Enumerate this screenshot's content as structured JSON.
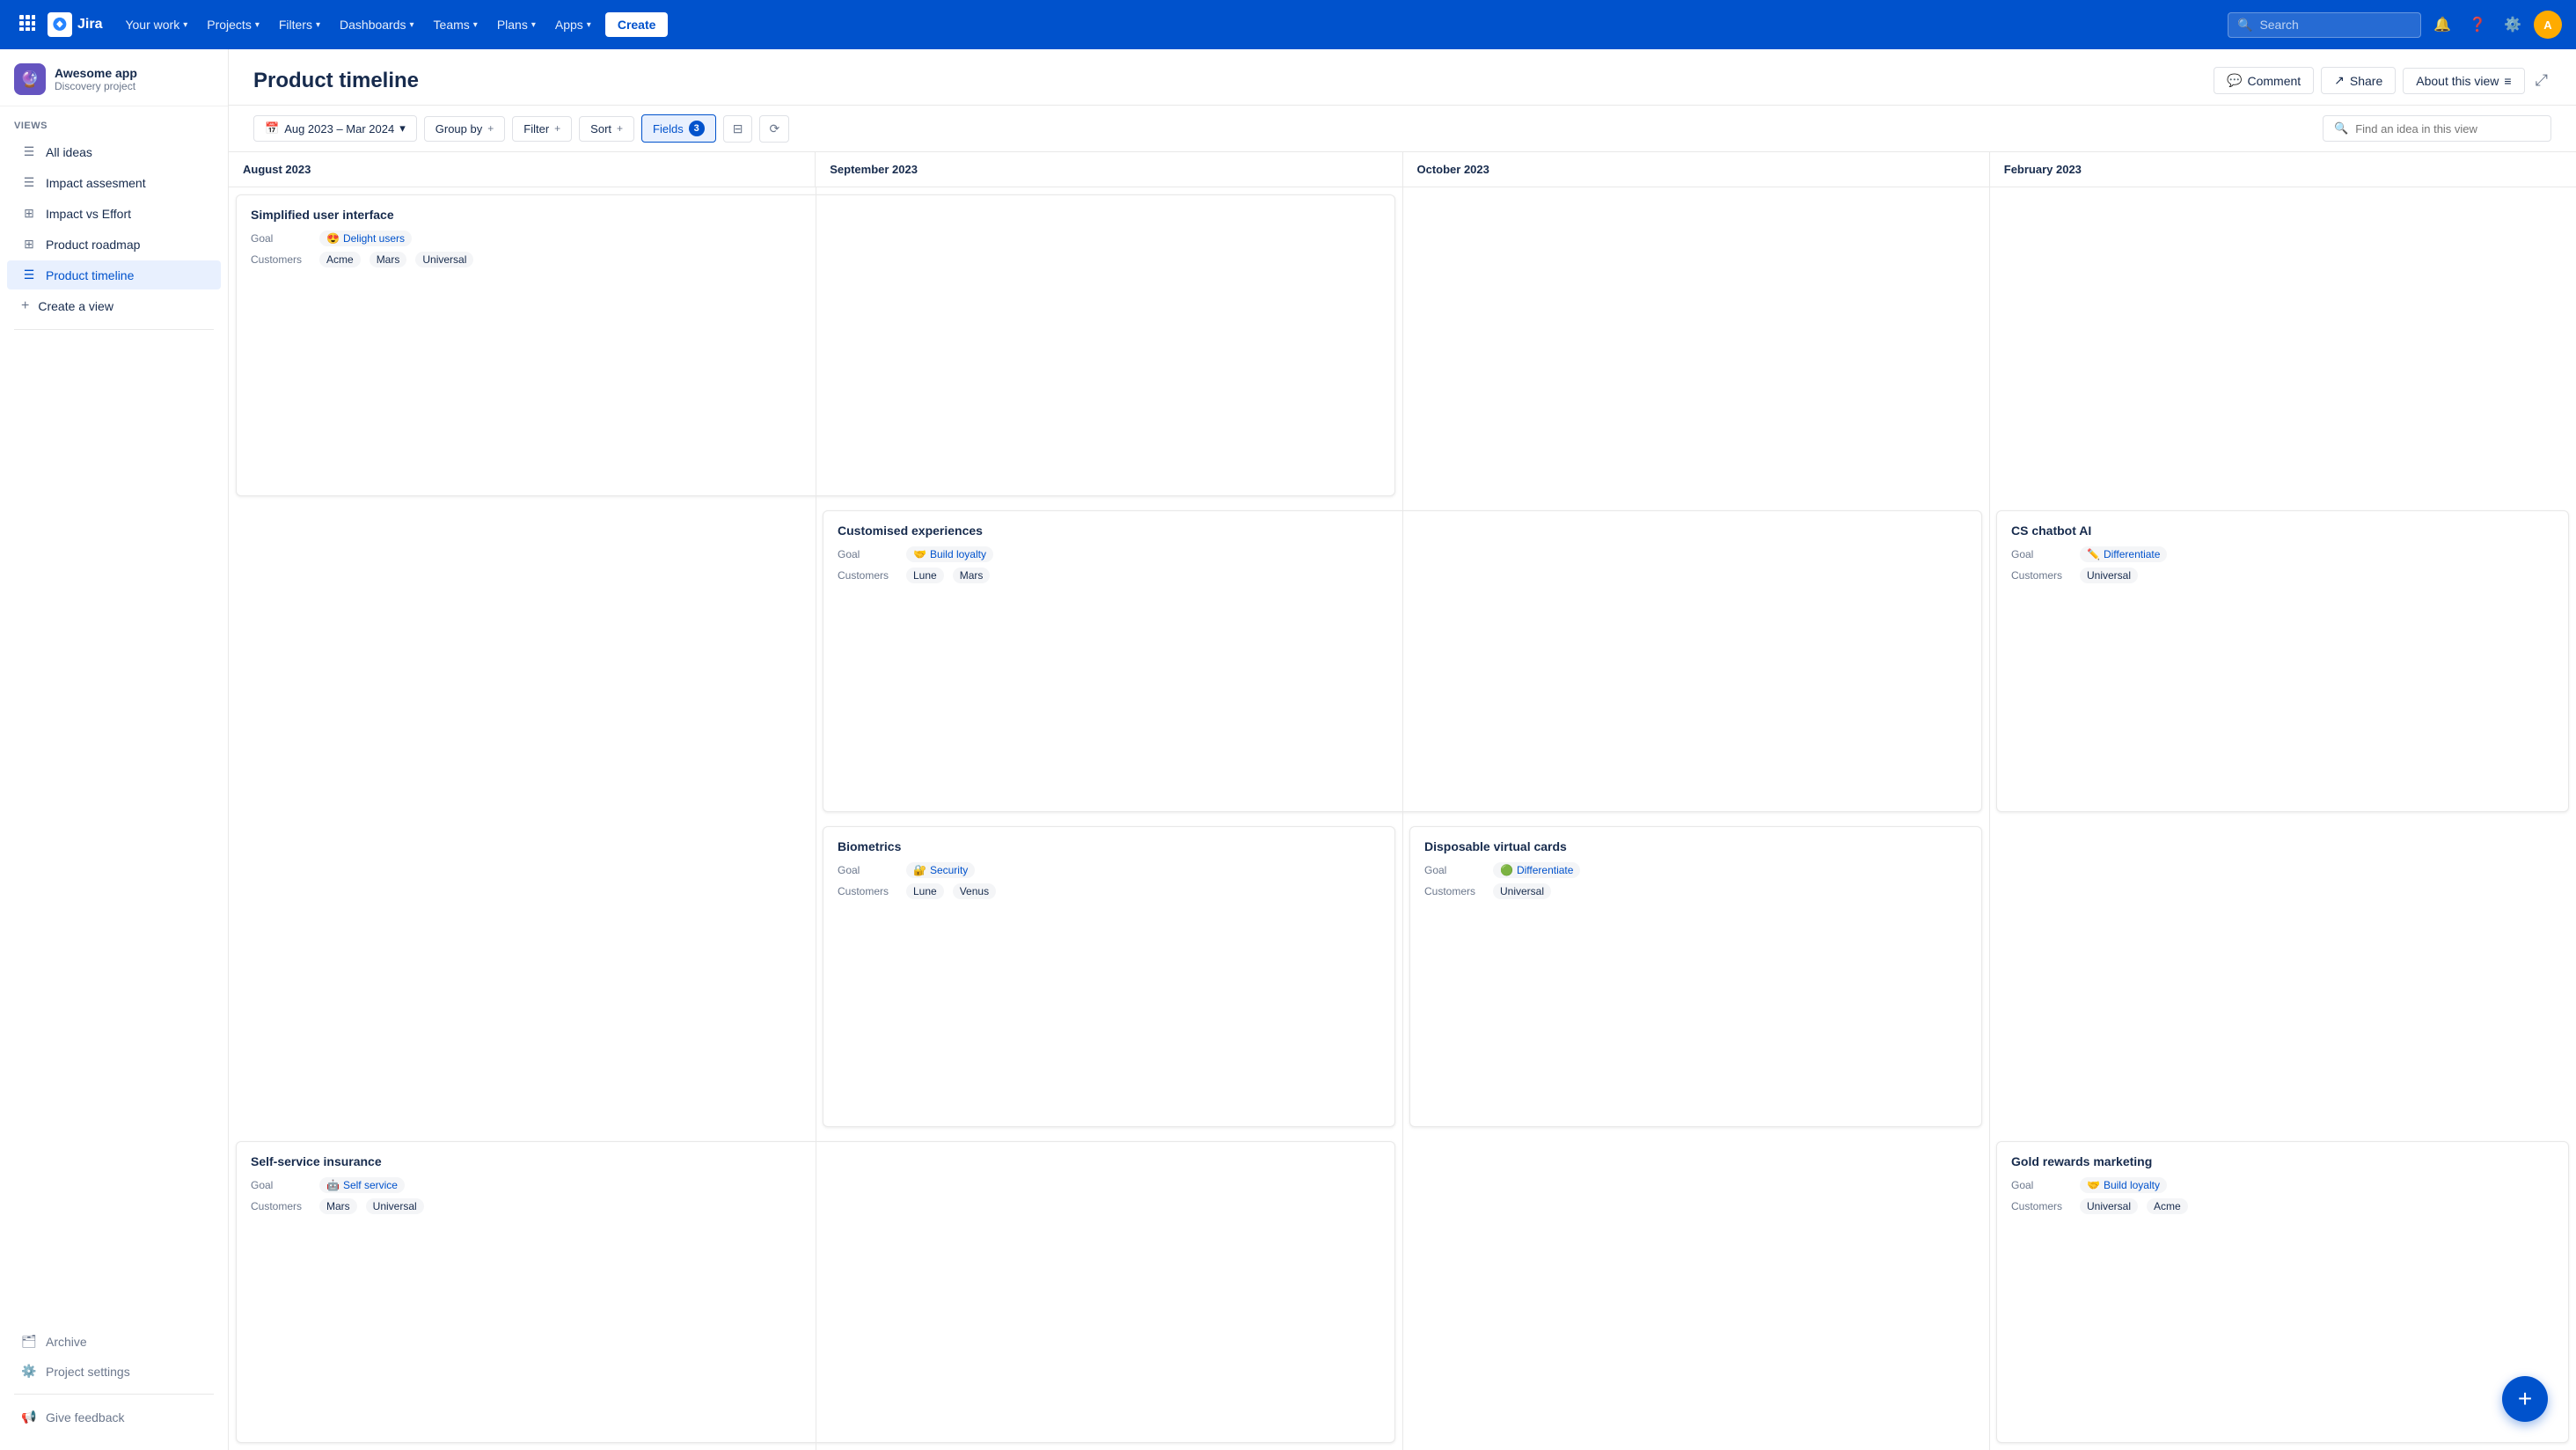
{
  "nav": {
    "logo_text": "Jira",
    "items": [
      {
        "label": "Your work",
        "has_dropdown": true
      },
      {
        "label": "Projects",
        "has_dropdown": true
      },
      {
        "label": "Filters",
        "has_dropdown": true
      },
      {
        "label": "Dashboards",
        "has_dropdown": true
      },
      {
        "label": "Teams",
        "has_dropdown": true
      },
      {
        "label": "Plans",
        "has_dropdown": true
      },
      {
        "label": "Apps",
        "has_dropdown": true
      }
    ],
    "create_label": "Create",
    "search_placeholder": "Search"
  },
  "sidebar": {
    "project_name": "Awesome app",
    "project_sub": "Discovery project",
    "views_label": "VIEWS",
    "add_view_label": "+",
    "items": [
      {
        "label": "All ideas",
        "icon": "☰"
      },
      {
        "label": "Impact assesment",
        "icon": "☰"
      },
      {
        "label": "Impact vs Effort",
        "icon": "⊞"
      },
      {
        "label": "Product roadmap",
        "icon": "⊞"
      },
      {
        "label": "Product timeline",
        "icon": "☰",
        "active": true
      }
    ],
    "create_view_label": "Create a view",
    "archive_label": "Archive",
    "settings_label": "Project settings",
    "feedback_label": "Give feedback"
  },
  "page": {
    "title": "Product timeline",
    "comment_label": "Comment",
    "share_label": "Share",
    "about_label": "About this view"
  },
  "toolbar": {
    "date_range": "Aug 2023 – Mar 2024",
    "group_by_label": "Group by",
    "filter_label": "Filter",
    "sort_label": "Sort",
    "fields_label": "Fields",
    "fields_count": "3",
    "search_placeholder": "Find an idea in this view"
  },
  "months": [
    {
      "label": "August 2023"
    },
    {
      "label": "September 2023"
    },
    {
      "label": "October 2023"
    },
    {
      "label": "February 2023"
    }
  ],
  "ideas": [
    {
      "id": "card1",
      "title": "Simplified user interface",
      "goal_emoji": "😍",
      "goal_label": "Delight users",
      "goal_type": "delight",
      "customers": [
        "Acme",
        "Mars",
        "Universal"
      ],
      "col_start": 1,
      "col_end": 3,
      "row": 1
    },
    {
      "id": "card2",
      "title": "Customised experiences",
      "goal_emoji": "🤝",
      "goal_label": "Build loyalty",
      "goal_type": "loyalty",
      "customers": [
        "Lune",
        "Mars"
      ],
      "col_start": 2,
      "col_end": 4,
      "row": 2
    },
    {
      "id": "card3",
      "title": "CS chatbot AI",
      "goal_emoji": "✏️",
      "goal_label": "Differentiate",
      "goal_type": "differentiate",
      "customers": [
        "Universal"
      ],
      "col_start": 4,
      "col_end": 5,
      "row": 2
    },
    {
      "id": "card4",
      "title": "Biometrics",
      "goal_emoji": "🔐",
      "goal_label": "Security",
      "goal_type": "security",
      "customers": [
        "Lune",
        "Venus"
      ],
      "col_start": 2,
      "col_end": 3,
      "row": 3
    },
    {
      "id": "card5",
      "title": "Disposable virtual cards",
      "goal_emoji": "🟢",
      "goal_label": "Differentiate",
      "goal_type": "differentiate",
      "customers": [
        "Universal"
      ],
      "col_start": 3,
      "col_end": 4,
      "row": 3
    },
    {
      "id": "card6",
      "title": "Self-service insurance",
      "goal_emoji": "🤖",
      "goal_label": "Self service",
      "goal_type": "self-service",
      "customers": [
        "Mars",
        "Universal"
      ],
      "col_start": 1,
      "col_end": 3,
      "row": 4
    },
    {
      "id": "card7",
      "title": "Gold rewards marketing",
      "goal_emoji": "🤝",
      "goal_label": "Build loyalty",
      "goal_type": "loyalty",
      "customers": [
        "Universal",
        "Acme"
      ],
      "col_start": 4,
      "col_end": 5,
      "row": 4
    }
  ],
  "fab_label": "+"
}
